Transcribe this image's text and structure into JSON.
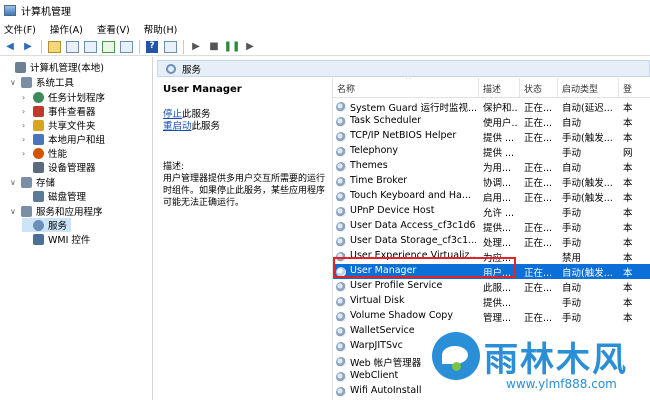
{
  "window": {
    "title": "计算机管理"
  },
  "menu": [
    "文件(F)",
    "操作(A)",
    "查看(V)",
    "帮助(H)"
  ],
  "tree": [
    {
      "label": "计算机管理(本地)",
      "arrow": "",
      "color": "#6d7f94"
    },
    {
      "label": "系统工具",
      "arrow": "∨",
      "color": "#7a8ea5"
    },
    {
      "label": "任务计划程序",
      "arrow": "›",
      "color": "#3d8a5a"
    },
    {
      "label": "事件查看器",
      "arrow": "›",
      "color": "#c0392b"
    },
    {
      "label": "共享文件夹",
      "arrow": "›",
      "color": "#d8a520"
    },
    {
      "label": "本地用户和组",
      "arrow": "›",
      "color": "#4a76b8"
    },
    {
      "label": "性能",
      "arrow": "›",
      "color": "#d35400"
    },
    {
      "label": "设备管理器",
      "arrow": "",
      "color": "#5a6b80"
    },
    {
      "label": "存储",
      "arrow": "∨",
      "color": "#7a8ea5"
    },
    {
      "label": "磁盘管理",
      "arrow": "",
      "color": "#5b7b98"
    },
    {
      "label": "服务和应用程序",
      "arrow": "∨",
      "color": "#7a8ea5"
    },
    {
      "label": "服务",
      "arrow": "",
      "color": "#6a8fb8"
    },
    {
      "label": "WMI 控件",
      "arrow": "",
      "color": "#4c6f96"
    }
  ],
  "services_header": "服务",
  "description": {
    "title": "User Manager",
    "stop_link": "停止",
    "stop_suffix": "此服务",
    "restart_link": "重启动",
    "restart_suffix": "此服务",
    "desc_label": "描述:",
    "desc_text": "用户管理器提供多用户交互所需要的运行时组件。如果停止此服务，某些应用程序可能无法正确运行。"
  },
  "table": {
    "columns": [
      "名称",
      "描述",
      "状态",
      "启动类型",
      "登"
    ],
    "rows": [
      [
        "System Guard 运行时监视...",
        "保护和...",
        "正在...",
        "自动(延迟...",
        "本"
      ],
      [
        "Task Scheduler",
        "使用户...",
        "正在...",
        "自动",
        "本"
      ],
      [
        "TCP/IP NetBIOS Helper",
        "提供 ...",
        "正在...",
        "手动(触发...",
        "本"
      ],
      [
        "Telephony",
        "提供 ...",
        "",
        "手动",
        "网"
      ],
      [
        "Themes",
        "为用...",
        "正在...",
        "自动",
        "本"
      ],
      [
        "Time Broker",
        "协调...",
        "正在...",
        "手动(触发...",
        "本"
      ],
      [
        "Touch Keyboard and Ha...",
        "启用...",
        "正在...",
        "手动(触发...",
        "本"
      ],
      [
        "UPnP Device Host",
        "允许 ...",
        "",
        "手动",
        "本"
      ],
      [
        "User Data Access_cf3c1d6",
        "提供...",
        "正在...",
        "手动",
        "本"
      ],
      [
        "User Data Storage_cf3c1...",
        "处理...",
        "正在...",
        "手动",
        "本"
      ],
      [
        "User Experience Virtualiz...",
        "为应...",
        "",
        "禁用",
        "本"
      ],
      [
        "User Manager",
        "用户...",
        "正在...",
        "自动(触发...",
        "本"
      ],
      [
        "User Profile Service",
        "此服...",
        "正在...",
        "自动",
        "本"
      ],
      [
        "Virtual Disk",
        "提供...",
        "",
        "手动",
        "本"
      ],
      [
        "Volume Shadow Copy",
        "管理...",
        "正在...",
        "手动",
        "本"
      ],
      [
        "WalletService",
        "",
        "",
        "",
        ""
      ],
      [
        "WarpJITSvc",
        "",
        "",
        "",
        ""
      ],
      [
        "Web 帐户管理器",
        "",
        "",
        "",
        ""
      ],
      [
        "WebClient",
        "",
        "",
        "",
        ""
      ],
      [
        "Wifi AutoInstall",
        "",
        "",
        "",
        ""
      ]
    ],
    "selected_index": 11
  },
  "watermark": {
    "name": "雨林木风",
    "url": "www.ylmf888.com"
  },
  "colors": {
    "selection": "#0a6fd6",
    "highlight": "#e0242a",
    "link": "#1a4fb8",
    "watermark": "#2a8fd6"
  }
}
